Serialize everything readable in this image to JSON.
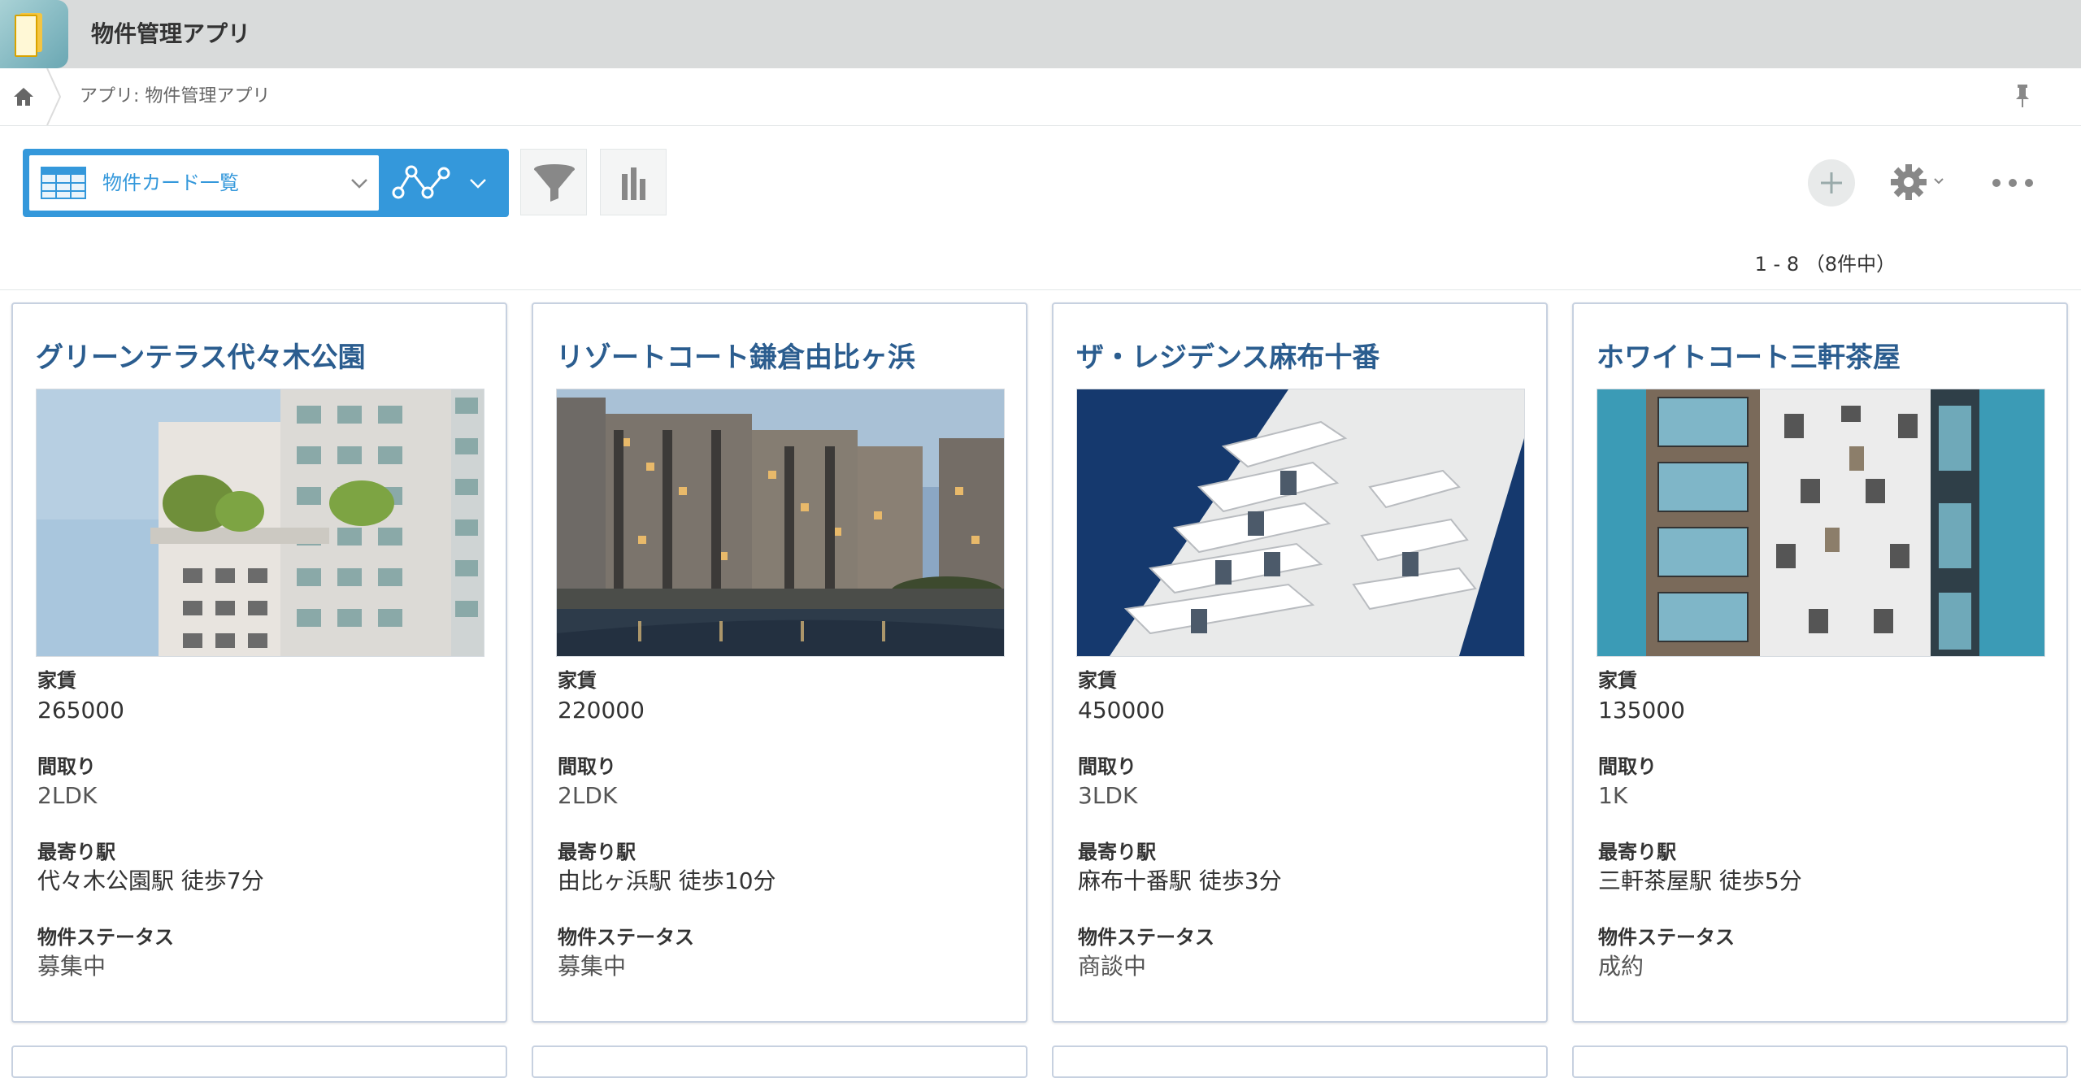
{
  "app": {
    "title": "物件管理アプリ"
  },
  "breadcrumb": {
    "text": "アプリ: 物件管理アプリ"
  },
  "toolbar": {
    "view_label": "物件カード一覧",
    "pager_text": "1 - 8 （8件中）"
  },
  "icons": {
    "home": "home-icon",
    "pin": "pin-icon",
    "view": "grid-view-icon",
    "graph": "graph-icon",
    "filter": "filter-icon",
    "chart": "bar-chart-icon",
    "add": "plus-icon",
    "settings": "gear-icon",
    "more": "more-icon"
  },
  "colors": {
    "accent": "#3498db",
    "card_title": "#2b5d8f",
    "header_bg": "#d9dbdb"
  },
  "fields": {
    "rent": "家賃",
    "layout": "間取り",
    "station": "最寄り駅",
    "status": "物件ステータス"
  },
  "cards": [
    {
      "title": "グリーンテラス代々木公園",
      "rent": "265000",
      "layout": "2LDK",
      "station": "代々木公園駅 徒歩7分",
      "status": "募集中"
    },
    {
      "title": "リゾートコート鎌倉由比ヶ浜",
      "rent": "220000",
      "layout": "2LDK",
      "station": "由比ヶ浜駅 徒歩10分",
      "status": "募集中"
    },
    {
      "title": "ザ・レジデンス麻布十番",
      "rent": "450000",
      "layout": "3LDK",
      "station": "麻布十番駅 徒歩3分",
      "status": "商談中"
    },
    {
      "title": "ホワイトコート三軒茶屋",
      "rent": "135000",
      "layout": "1K",
      "station": "三軒茶屋駅 徒歩5分",
      "status": "成約"
    }
  ]
}
